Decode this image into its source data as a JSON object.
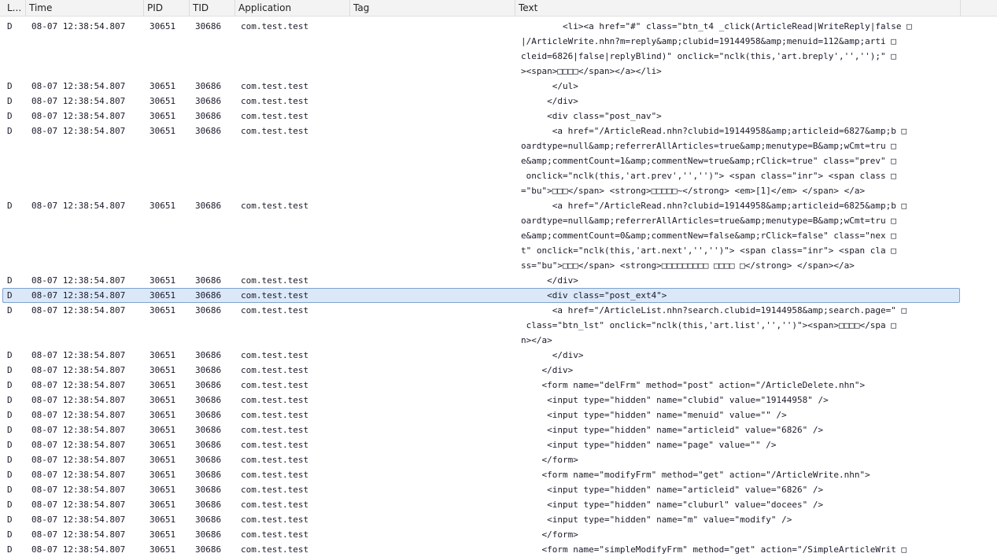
{
  "columns": {
    "level": "L...",
    "time": "Time",
    "pid": "PID",
    "tid": "TID",
    "application": "Application",
    "tag": "Tag",
    "text": "Text"
  },
  "rows": [
    {
      "level": "D",
      "time": "08-07 12:38:54.807",
      "pid": "30651",
      "tid": "30686",
      "app": "com.test.test",
      "lines": [
        "        <li><a href=\"#\" class=\"btn_t4 _click(ArticleRead|WriteReply|false □",
        "|/ArticleWrite.nhn?m=reply&amp;clubid=19144958&amp;menuid=112&amp;arti □",
        "cleid=6826|false|replyBlind)\" onclick=\"nclk(this,'art.breply','','');\" □",
        "><span>□□□□</span></a></li>"
      ]
    },
    {
      "level": "D",
      "time": "08-07 12:38:54.807",
      "pid": "30651",
      "tid": "30686",
      "app": "com.test.test",
      "lines": [
        "      </ul>"
      ]
    },
    {
      "level": "D",
      "time": "08-07 12:38:54.807",
      "pid": "30651",
      "tid": "30686",
      "app": "com.test.test",
      "lines": [
        "     </div>"
      ]
    },
    {
      "level": "D",
      "time": "08-07 12:38:54.807",
      "pid": "30651",
      "tid": "30686",
      "app": "com.test.test",
      "lines": [
        "     <div class=\"post_nav\">"
      ]
    },
    {
      "level": "D",
      "time": "08-07 12:38:54.807",
      "pid": "30651",
      "tid": "30686",
      "app": "com.test.test",
      "lines": [
        "      <a href=\"/ArticleRead.nhn?clubid=19144958&amp;articleid=6827&amp;b □",
        "oardtype=null&amp;referrerAllArticles=true&amp;menutype=B&amp;wCmt=tru □",
        "e&amp;commentCount=1&amp;commentNew=true&amp;rClick=true\" class=\"prev\" □",
        " onclick=\"nclk(this,'art.prev','','')\"> <span class=\"inr\"> <span class □",
        "=\"bu\">□□□</span> <strong>□□□□□~</strong> <em>[1]</em> </span> </a>"
      ]
    },
    {
      "level": "D",
      "time": "08-07 12:38:54.807",
      "pid": "30651",
      "tid": "30686",
      "app": "com.test.test",
      "lines": [
        "      <a href=\"/ArticleRead.nhn?clubid=19144958&amp;articleid=6825&amp;b □",
        "oardtype=null&amp;referrerAllArticles=true&amp;menutype=B&amp;wCmt=tru □",
        "e&amp;commentCount=0&amp;commentNew=false&amp;rClick=false\" class=\"nex □",
        "t\" onclick=\"nclk(this,'art.next','','')\"> <span class=\"inr\"> <span cla □",
        "ss=\"bu\">□□□</span> <strong>□□□□□□□□□ □□□□ □</strong> </span></a>"
      ]
    },
    {
      "level": "D",
      "time": "08-07 12:38:54.807",
      "pid": "30651",
      "tid": "30686",
      "app": "com.test.test",
      "lines": [
        "     </div>"
      ]
    },
    {
      "level": "D",
      "time": "08-07 12:38:54.807",
      "pid": "30651",
      "tid": "30686",
      "app": "com.test.test",
      "selected": true,
      "lines": [
        "     <div class=\"post_ext4\">"
      ]
    },
    {
      "level": "D",
      "time": "08-07 12:38:54.807",
      "pid": "30651",
      "tid": "30686",
      "app": "com.test.test",
      "lines": [
        "      <a href=\"/ArticleList.nhn?search.clubid=19144958&amp;search.page=\" □",
        " class=\"btn_lst\" onclick=\"nclk(this,'art.list','','')\"><span>□□□□</spa □",
        "n></a>"
      ]
    },
    {
      "level": "D",
      "time": "08-07 12:38:54.807",
      "pid": "30651",
      "tid": "30686",
      "app": "com.test.test",
      "lines": [
        "      </div>"
      ]
    },
    {
      "level": "D",
      "time": "08-07 12:38:54.807",
      "pid": "30651",
      "tid": "30686",
      "app": "com.test.test",
      "lines": [
        "    </div>"
      ]
    },
    {
      "level": "D",
      "time": "08-07 12:38:54.807",
      "pid": "30651",
      "tid": "30686",
      "app": "com.test.test",
      "lines": [
        "    <form name=\"delFrm\" method=\"post\" action=\"/ArticleDelete.nhn\">"
      ]
    },
    {
      "level": "D",
      "time": "08-07 12:38:54.807",
      "pid": "30651",
      "tid": "30686",
      "app": "com.test.test",
      "lines": [
        "     <input type=\"hidden\" name=\"clubid\" value=\"19144958\" />"
      ]
    },
    {
      "level": "D",
      "time": "08-07 12:38:54.807",
      "pid": "30651",
      "tid": "30686",
      "app": "com.test.test",
      "lines": [
        "     <input type=\"hidden\" name=\"menuid\" value=\"\" />"
      ]
    },
    {
      "level": "D",
      "time": "08-07 12:38:54.807",
      "pid": "30651",
      "tid": "30686",
      "app": "com.test.test",
      "lines": [
        "     <input type=\"hidden\" name=\"articleid\" value=\"6826\" />"
      ]
    },
    {
      "level": "D",
      "time": "08-07 12:38:54.807",
      "pid": "30651",
      "tid": "30686",
      "app": "com.test.test",
      "lines": [
        "     <input type=\"hidden\" name=\"page\" value=\"\" />"
      ]
    },
    {
      "level": "D",
      "time": "08-07 12:38:54.807",
      "pid": "30651",
      "tid": "30686",
      "app": "com.test.test",
      "lines": [
        "    </form>"
      ]
    },
    {
      "level": "D",
      "time": "08-07 12:38:54.807",
      "pid": "30651",
      "tid": "30686",
      "app": "com.test.test",
      "lines": [
        "    <form name=\"modifyFrm\" method=\"get\" action=\"/ArticleWrite.nhn\">"
      ]
    },
    {
      "level": "D",
      "time": "08-07 12:38:54.807",
      "pid": "30651",
      "tid": "30686",
      "app": "com.test.test",
      "lines": [
        "     <input type=\"hidden\" name=\"articleid\" value=\"6826\" />"
      ]
    },
    {
      "level": "D",
      "time": "08-07 12:38:54.807",
      "pid": "30651",
      "tid": "30686",
      "app": "com.test.test",
      "lines": [
        "     <input type=\"hidden\" name=\"cluburl\" value=\"docees\" />"
      ]
    },
    {
      "level": "D",
      "time": "08-07 12:38:54.807",
      "pid": "30651",
      "tid": "30686",
      "app": "com.test.test",
      "lines": [
        "     <input type=\"hidden\" name=\"m\" value=\"modify\" />"
      ]
    },
    {
      "level": "D",
      "time": "08-07 12:38:54.807",
      "pid": "30651",
      "tid": "30686",
      "app": "com.test.test",
      "lines": [
        "    </form>"
      ]
    },
    {
      "level": "D",
      "time": "08-07 12:38:54.807",
      "pid": "30651",
      "tid": "30686",
      "app": "com.test.test",
      "lines": [
        "    <form name=\"simpleModifyFrm\" method=\"get\" action=\"/SimpleArticleWrit □"
      ]
    }
  ]
}
